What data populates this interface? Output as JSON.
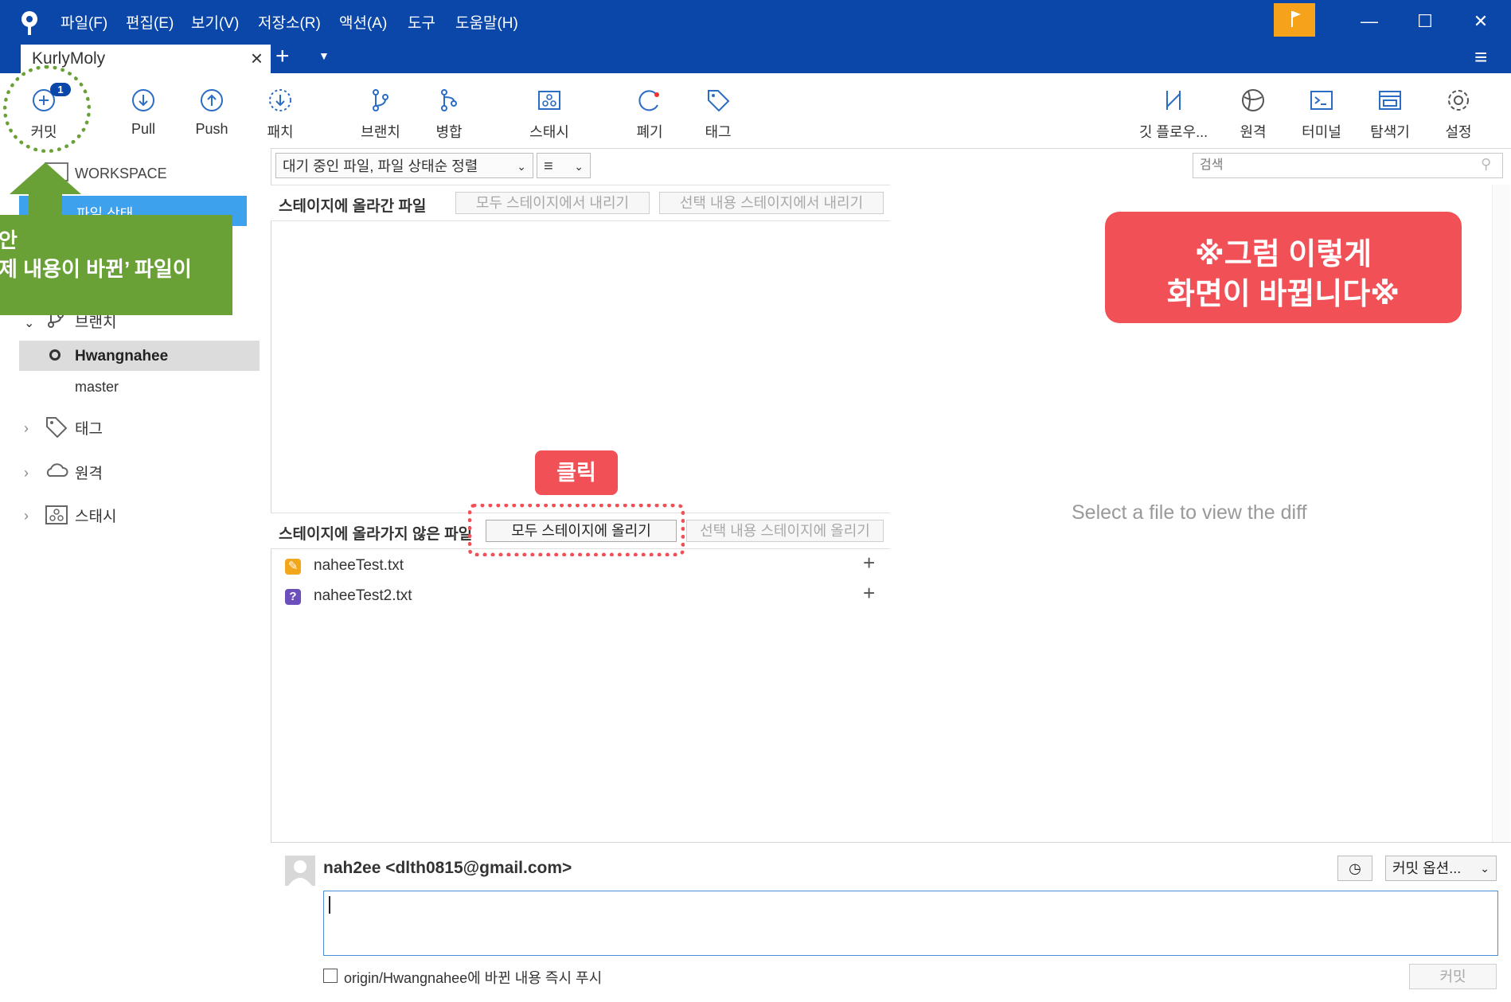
{
  "app": {
    "menu": [
      "파일(F)",
      "편집(E)",
      "보기(V)",
      "저장소(R)",
      "액션(A)",
      "도구",
      "도움말(H)"
    ],
    "tab_title": "KurlyMoly",
    "accent": "#0a47a9"
  },
  "toolbar": {
    "commit_badge": "1",
    "left": [
      {
        "label": "커밋",
        "icon": "commit-icon"
      },
      {
        "label": "Pull",
        "icon": "pull-icon"
      },
      {
        "label": "Push",
        "icon": "push-icon"
      },
      {
        "label": "패치",
        "icon": "patch-icon"
      },
      {
        "label": "브랜치",
        "icon": "branch-icon"
      },
      {
        "label": "병합",
        "icon": "merge-icon"
      },
      {
        "label": "스태시",
        "icon": "stash-icon"
      },
      {
        "label": "폐기",
        "icon": "discard-icon"
      },
      {
        "label": "태그",
        "icon": "tag-icon"
      }
    ],
    "right": [
      {
        "label": "깃 플로우...",
        "icon": "git-flow-icon"
      },
      {
        "label": "원격",
        "icon": "globe-icon"
      },
      {
        "label": "터미널",
        "icon": "terminal-icon"
      },
      {
        "label": "탐색기",
        "icon": "explorer-icon"
      },
      {
        "label": "설정",
        "icon": "gear-icon"
      }
    ]
  },
  "sidebar": {
    "workspace": "WORKSPACE",
    "file_status": "파일 상태",
    "branches_label": "브랜치",
    "branches": [
      "Hwangnahee",
      "master"
    ],
    "tags_label": "태그",
    "remotes_label": "원격",
    "stash_label": "스태시"
  },
  "filters": {
    "sort_label": "대기 중인 파일, 파일 상태순 정렬",
    "view_label": "≡",
    "search_placeholder": "검색"
  },
  "staged": {
    "title": "스테이지에 올라간 파일",
    "unstage_all": "모두 스테이지에서 내리기",
    "unstage_selected": "선택 내용 스테이지에서 내리기"
  },
  "unstaged": {
    "title": "스테이지에 올라가지 않은 파일",
    "stage_all": "모두 스테이지에 올리기",
    "stage_selected": "선택 내용 스테이지에 올리기",
    "files": [
      {
        "name": "naheeTest.txt",
        "status": "modified",
        "color": "#f2a71b",
        "glyph": "✎"
      },
      {
        "name": "naheeTest2.txt",
        "status": "untracked",
        "color": "#6b4fbb",
        "glyph": "?"
      }
    ]
  },
  "diff": {
    "placeholder": "Select a file to view the diff"
  },
  "commit": {
    "author": "nah2ee <dlth0815@gmail.com>",
    "options_label": "커밋 옵션...",
    "push_checkbox": "origin/Hwangnahee에 바뀐 내용 즉시 푸시",
    "commit_button": "커밋"
  },
  "annotations": {
    "green_line1": "안",
    "green_line2": "제 내용이 바뀐’ 파일이",
    "click_label": "클릭",
    "red_line1": "※그럼 이렇게",
    "red_line2": "화면이 바뀝니다※"
  }
}
